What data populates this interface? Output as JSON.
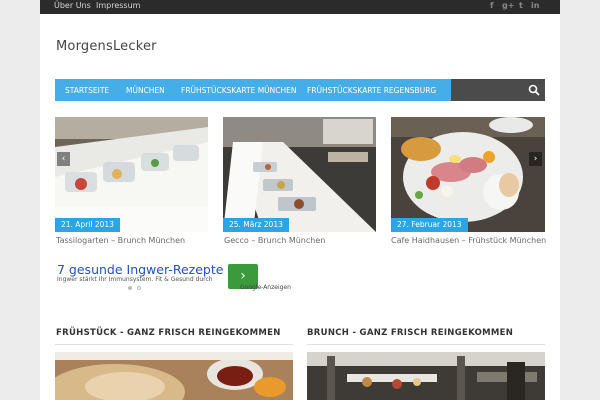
{
  "topbar": {
    "links": [
      "Über Uns",
      "Impressum"
    ],
    "social": [
      "f",
      "g+",
      "t",
      "in"
    ]
  },
  "site": {
    "logo": "MorgensLecker"
  },
  "nav": {
    "items": [
      "STARTSEITE",
      "MÜNCHEN",
      "FRÜHSTÜCKSKARTE MÜNCHEN",
      "FRÜHSTÜCKSKARTE REGENSBURG"
    ],
    "search_icon": "search-icon"
  },
  "slider": {
    "prev_label": "‹",
    "next_label": "›",
    "slides": [
      {
        "date": "21. April 2013",
        "caption": "Tassilogarten – Brunch München"
      },
      {
        "date": "25. März 2013",
        "caption": "Gecco – Brunch München"
      },
      {
        "date": "27. Februar 2013",
        "caption": "Cafe Haidhausen – Frühstück München"
      }
    ]
  },
  "ad": {
    "title": "7 gesunde Ingwer-Rezepte",
    "text": "Ingwer stärkt Ihr Immunsystem. Fit & Gesund durch",
    "button": "›",
    "label": "Google-Anzeigen"
  },
  "sections": [
    {
      "title": "FRÜHSTÜCK - GANZ FRISCH REINGEKOMMEN"
    },
    {
      "title": "BRUNCH - GANZ FRISCH REINGEKOMMEN"
    }
  ],
  "colors": {
    "nav_accent": "#45aee8",
    "badge": "#2aa6e6",
    "topbar": "#2b2b2b",
    "ad_link": "#1f4fd1",
    "ad_button": "#3b9a3c"
  }
}
